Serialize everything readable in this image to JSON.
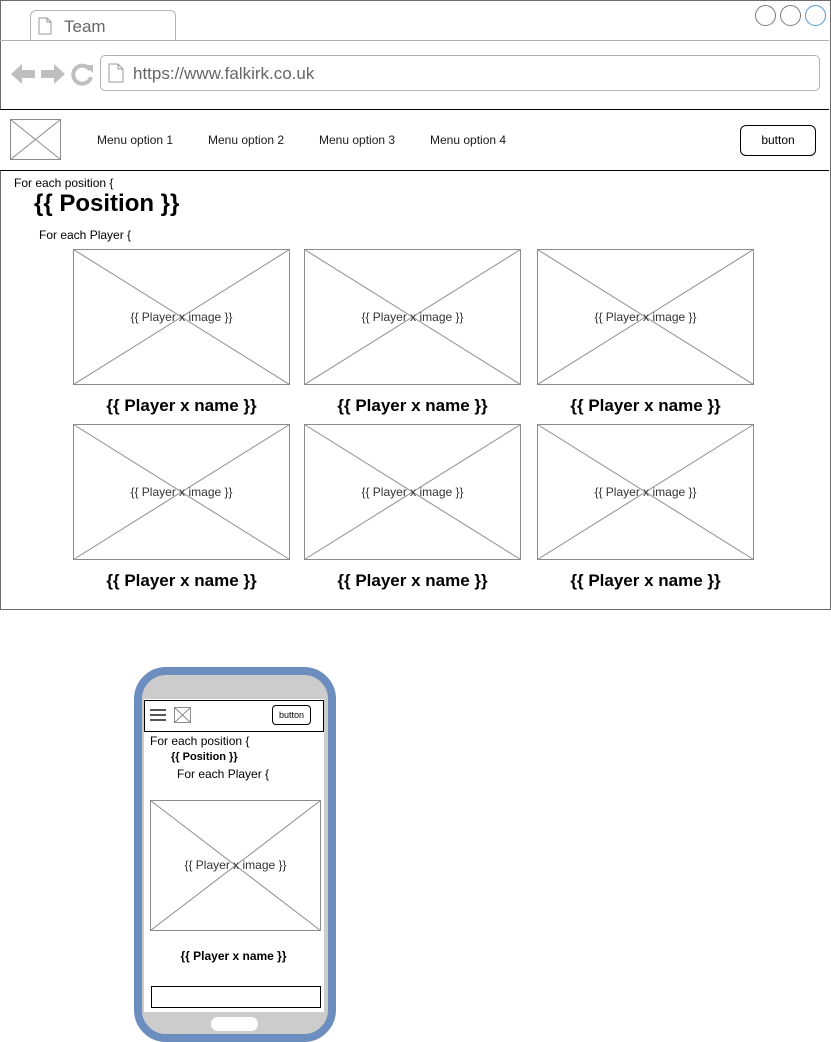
{
  "browser": {
    "tab_title": "Team",
    "url": "https://www.falkirk.co.uk",
    "window_controls": [
      "minimize-circle",
      "maximize-circle",
      "close-circle"
    ],
    "icons": [
      "page-icon",
      "back-arrow-icon",
      "forward-arrow-icon",
      "reload-icon"
    ]
  },
  "desktop": {
    "nav": {
      "menu": [
        "Menu option 1",
        "Menu option 2",
        "Menu option 3",
        "Menu option 4"
      ],
      "button": "button"
    },
    "loop_position": "For each position {",
    "position_heading": "{{ Position }}",
    "loop_player": "For each Player {",
    "players": [
      {
        "image": "{{ Player x image }}",
        "name": "{{ Player x name }}"
      },
      {
        "image": "{{ Player x image }}",
        "name": "{{ Player x name }}"
      },
      {
        "image": "{{ Player x image }}",
        "name": "{{ Player x name }}"
      },
      {
        "image": "{{ Player x image }}",
        "name": "{{ Player x name }}"
      },
      {
        "image": "{{ Player x image }}",
        "name": "{{ Player x name }}"
      },
      {
        "image": "{{ Player x image }}",
        "name": "{{ Player x name }}"
      }
    ]
  },
  "mobile": {
    "nav_button": "button",
    "loop_position": "For each position {",
    "position_heading": "{{ Position }}",
    "loop_player": "For each Player {",
    "player": {
      "image": "{{ Player x image }}",
      "name": "{{ Player x name }}"
    },
    "icons": [
      "hamburger-menu-icon",
      "logo-placeholder-icon"
    ]
  },
  "colors": {
    "phone_frame": "#6c8ebf",
    "phone_body": "#cccccc",
    "placeholder_stroke": "#8c8c8c",
    "browser_icon_grey": "#bfbfbf"
  }
}
